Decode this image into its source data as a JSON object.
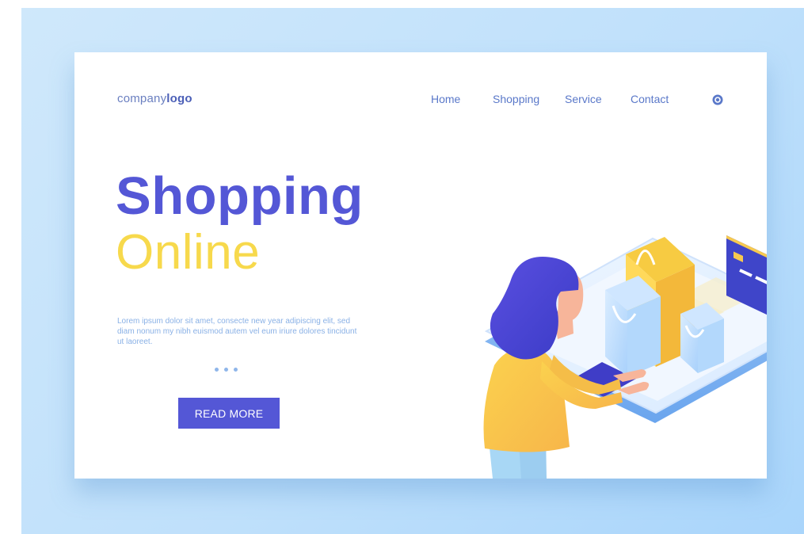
{
  "header": {
    "logo": {
      "prefix": "company",
      "bold": "logo"
    },
    "nav": [
      "Home",
      "Shopping",
      "Service",
      "Contact"
    ],
    "search_icon": "search-icon"
  },
  "hero": {
    "title": "Shopping",
    "subtitle": "Online",
    "description": "Lorem ipsum dolor sit amet, consecte new year adipiscing elit, sed diam nonum my nibh euismod autem vel eum iriure dolores tincidunt ut laoreet.",
    "carousel_dots": 3,
    "cta_label": "READ MORE"
  },
  "colors": {
    "background": "#c4e2fb",
    "accent": "#5457d6",
    "highlight": "#f7d94c",
    "nav_text": "#5a78c9"
  }
}
